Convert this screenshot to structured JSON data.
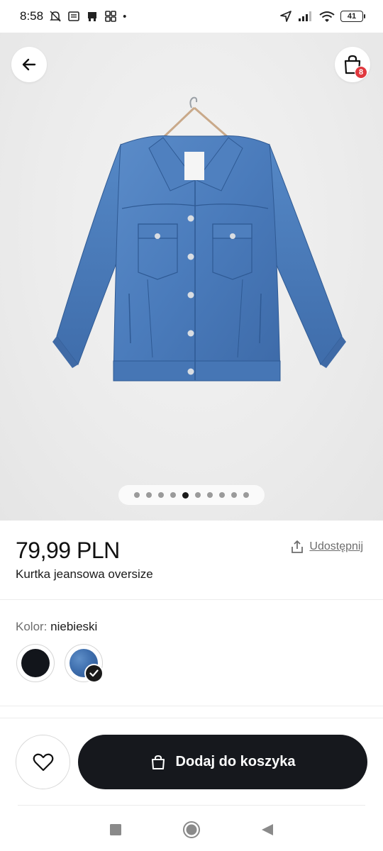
{
  "status_bar": {
    "time": "8:58",
    "battery": "41",
    "icons": [
      "mute-icon",
      "news-icon",
      "store-icon",
      "apps-icon",
      "dot-icon",
      "location-icon",
      "signal-icon",
      "wifi-icon",
      "battery-icon"
    ]
  },
  "header": {
    "back_icon": "arrow-left-icon",
    "bag_icon": "shopping-bag-icon",
    "bag_count": "8"
  },
  "gallery": {
    "image": "denim-jacket",
    "image_count": 10,
    "active_index": 4
  },
  "product": {
    "price": "79,99 PLN",
    "name": "Kurtka jeansowa oversize",
    "share_label": "Udostępnij"
  },
  "color": {
    "label": "Kolor:",
    "value": "niebieski",
    "swatches": [
      {
        "name": "black",
        "color": "#12151b",
        "selected": false
      },
      {
        "name": "blue",
        "color": "#3f6fae",
        "selected": true
      }
    ]
  },
  "actions": {
    "add_to_cart_label": "Dodaj do koszyka"
  },
  "colors": {
    "accent": "#16181d",
    "badge": "#e0383e",
    "muted_text": "#6d6d6d"
  }
}
